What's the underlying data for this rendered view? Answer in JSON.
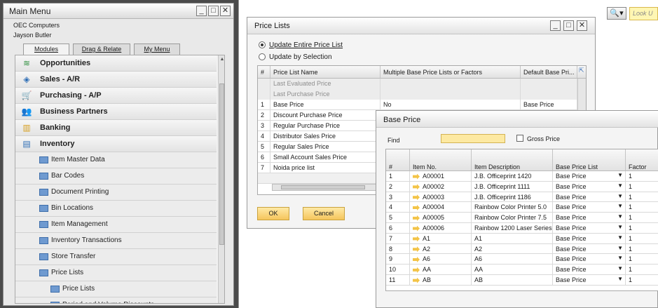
{
  "main_menu": {
    "title": "Main Menu",
    "company": "OEC Computers",
    "user": "Jayson Butler",
    "tabs": [
      "Modules",
      "Drag & Relate",
      "My Menu"
    ],
    "items": [
      {
        "label": "Opportunities",
        "level": 0,
        "icon": "opportunities-icon"
      },
      {
        "label": "Sales - A/R",
        "level": 0,
        "icon": "sales-icon"
      },
      {
        "label": "Purchasing - A/P",
        "level": 0,
        "icon": "cart-icon"
      },
      {
        "label": "Business Partners",
        "level": 0,
        "icon": "partners-icon"
      },
      {
        "label": "Banking",
        "level": 0,
        "icon": "banking-icon"
      },
      {
        "label": "Inventory",
        "level": 0,
        "icon": "inventory-icon"
      },
      {
        "label": "Item Master Data",
        "level": 1,
        "icon": "window-icon"
      },
      {
        "label": "Bar Codes",
        "level": 1,
        "icon": "window-icon"
      },
      {
        "label": "Document Printing",
        "level": 1,
        "icon": "window-icon"
      },
      {
        "label": "Bin Locations",
        "level": 1,
        "icon": "folder-icon"
      },
      {
        "label": "Item Management",
        "level": 1,
        "icon": "folder-icon"
      },
      {
        "label": "Inventory Transactions",
        "level": 1,
        "icon": "folder-icon"
      },
      {
        "label": "Store Transfer",
        "level": 1,
        "icon": "folder-icon"
      },
      {
        "label": "Price Lists",
        "level": 1,
        "icon": "folder-open-icon"
      },
      {
        "label": "Price Lists",
        "level": 2,
        "icon": "window-icon"
      },
      {
        "label": "Period and Volume Discounts",
        "level": 2,
        "icon": "window-icon"
      }
    ]
  },
  "toolbar": {
    "lookup_placeholder": "Look U"
  },
  "price_lists": {
    "title": "Price Lists",
    "radio_update_entire": "Update Entire Price List",
    "radio_update_selection": "Update by Selection",
    "columns": [
      "#",
      "Price List Name",
      "Multiple Base Price Lists or Factors",
      "Default Base Pri..."
    ],
    "rows": [
      {
        "num": "",
        "name": "Last Evaluated Price",
        "multi": "",
        "default": "",
        "state": "disabled"
      },
      {
        "num": "",
        "name": "Last Purchase Price",
        "multi": "",
        "default": "",
        "state": "disabled"
      },
      {
        "num": "1",
        "name": "Base Price",
        "multi": "No",
        "default": "Base Price",
        "state": "selected"
      },
      {
        "num": "2",
        "name": "Discount Purchase Price",
        "multi": "",
        "default": "",
        "state": ""
      },
      {
        "num": "3",
        "name": "Regular Purchase Price",
        "multi": "",
        "default": "",
        "state": ""
      },
      {
        "num": "4",
        "name": "Distributor Sales Price",
        "multi": "",
        "default": "",
        "state": ""
      },
      {
        "num": "5",
        "name": "Regular Sales Price",
        "multi": "",
        "default": "",
        "state": ""
      },
      {
        "num": "6",
        "name": "Small Account Sales Price",
        "multi": "",
        "default": "",
        "state": ""
      },
      {
        "num": "7",
        "name": "Noida price list",
        "multi": "",
        "default": "",
        "state": ""
      }
    ],
    "ok_label": "OK",
    "cancel_label": "Cancel"
  },
  "base_price": {
    "title": "Base Price",
    "find_label": "Find",
    "find_value": "",
    "gross_price_label": "Gross Price",
    "columns": [
      "#",
      "Item No.",
      "Item Description",
      "Base Price List",
      "Factor"
    ],
    "rows": [
      {
        "num": "1",
        "item": "A00001",
        "desc": "J.B. Officeprint 1420",
        "list": "Base Price",
        "factor": "1"
      },
      {
        "num": "2",
        "item": "A00002",
        "desc": "J.B. Officeprint 1111",
        "list": "Base Price",
        "factor": "1"
      },
      {
        "num": "3",
        "item": "A00003",
        "desc": "J.B. Officeprint 1186",
        "list": "Base Price",
        "factor": "1"
      },
      {
        "num": "4",
        "item": "A00004",
        "desc": "Rainbow Color Printer 5.0",
        "list": "Base Price",
        "factor": "1"
      },
      {
        "num": "5",
        "item": "A00005",
        "desc": "Rainbow Color Printer 7.5",
        "list": "Base Price",
        "factor": "1"
      },
      {
        "num": "6",
        "item": "A00006",
        "desc": "Rainbow 1200 Laser Series",
        "list": "Base Price",
        "factor": "1"
      },
      {
        "num": "7",
        "item": "A1",
        "desc": "A1",
        "list": "Base Price",
        "factor": "1"
      },
      {
        "num": "8",
        "item": "A2",
        "desc": "A2",
        "list": "Base Price",
        "factor": "1"
      },
      {
        "num": "9",
        "item": "A6",
        "desc": "A6",
        "list": "Base Price",
        "factor": "1"
      },
      {
        "num": "10",
        "item": "AA",
        "desc": "AA",
        "list": "Base Price",
        "factor": "1"
      },
      {
        "num": "11",
        "item": "AB",
        "desc": "AB",
        "list": "Base Price",
        "factor": "1"
      }
    ]
  }
}
